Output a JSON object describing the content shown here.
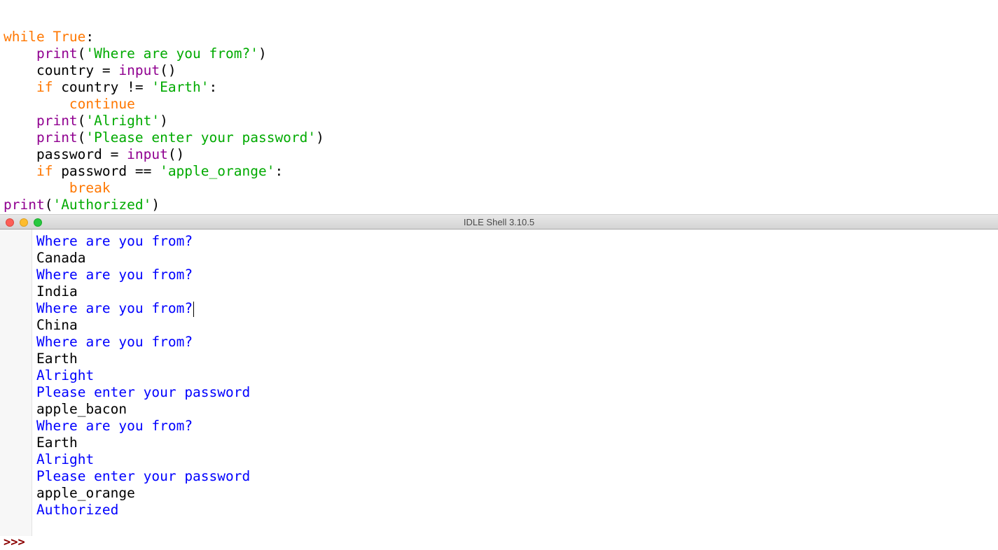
{
  "editor": {
    "lines": [
      [
        {
          "t": "while True",
          "c": "kw"
        },
        {
          "t": ":",
          "c": "plain"
        }
      ],
      [
        {
          "t": "    ",
          "c": "plain"
        },
        {
          "t": "print",
          "c": "bi"
        },
        {
          "t": "(",
          "c": "plain"
        },
        {
          "t": "'Where are you from?'",
          "c": "str"
        },
        {
          "t": ")",
          "c": "plain"
        }
      ],
      [
        {
          "t": "    country = ",
          "c": "plain"
        },
        {
          "t": "input",
          "c": "bi"
        },
        {
          "t": "()",
          "c": "plain"
        }
      ],
      [
        {
          "t": "    ",
          "c": "plain"
        },
        {
          "t": "if",
          "c": "kw"
        },
        {
          "t": " country != ",
          "c": "plain"
        },
        {
          "t": "'Earth'",
          "c": "str"
        },
        {
          "t": ":",
          "c": "plain"
        }
      ],
      [
        {
          "t": "        ",
          "c": "plain"
        },
        {
          "t": "continue",
          "c": "kw"
        }
      ],
      [
        {
          "t": "    ",
          "c": "plain"
        },
        {
          "t": "print",
          "c": "bi"
        },
        {
          "t": "(",
          "c": "plain"
        },
        {
          "t": "'Alright'",
          "c": "str"
        },
        {
          "t": ")",
          "c": "plain"
        }
      ],
      [
        {
          "t": "    ",
          "c": "plain"
        },
        {
          "t": "print",
          "c": "bi"
        },
        {
          "t": "(",
          "c": "plain"
        },
        {
          "t": "'Please enter your password'",
          "c": "str"
        },
        {
          "t": ")",
          "c": "plain"
        }
      ],
      [
        {
          "t": "    password = ",
          "c": "plain"
        },
        {
          "t": "input",
          "c": "bi"
        },
        {
          "t": "()",
          "c": "plain"
        }
      ],
      [
        {
          "t": "    ",
          "c": "plain"
        },
        {
          "t": "if",
          "c": "kw"
        },
        {
          "t": " password == ",
          "c": "plain"
        },
        {
          "t": "'apple_orange'",
          "c": "str"
        },
        {
          "t": ":",
          "c": "plain"
        }
      ],
      [
        {
          "t": "        ",
          "c": "plain"
        },
        {
          "t": "break",
          "c": "kw"
        }
      ],
      [
        {
          "t": "print",
          "c": "bi"
        },
        {
          "t": "(",
          "c": "plain"
        },
        {
          "t": "'Authorized'",
          "c": "str"
        },
        {
          "t": ")",
          "c": "plain"
        }
      ]
    ]
  },
  "shell": {
    "title": "IDLE Shell 3.10.5",
    "prompt": ">>>",
    "output": [
      {
        "text": "Where are you from?",
        "kind": "stdout"
      },
      {
        "text": "Canada",
        "kind": "stdin"
      },
      {
        "text": "Where are you from?",
        "kind": "stdout"
      },
      {
        "text": "India",
        "kind": "stdin"
      },
      {
        "text": "Where are you from?",
        "kind": "stdout",
        "cursor": true
      },
      {
        "text": "China",
        "kind": "stdin"
      },
      {
        "text": "Where are you from?",
        "kind": "stdout"
      },
      {
        "text": "Earth",
        "kind": "stdin"
      },
      {
        "text": "Alright",
        "kind": "stdout"
      },
      {
        "text": "Please enter your password",
        "kind": "stdout"
      },
      {
        "text": "apple_bacon",
        "kind": "stdin"
      },
      {
        "text": "Where are you from?",
        "kind": "stdout"
      },
      {
        "text": "Earth",
        "kind": "stdin"
      },
      {
        "text": "Alright",
        "kind": "stdout"
      },
      {
        "text": "Please enter your password",
        "kind": "stdout"
      },
      {
        "text": "apple_orange",
        "kind": "stdin"
      },
      {
        "text": "Authorized",
        "kind": "stdout"
      }
    ]
  },
  "colors": {
    "keyword": "#ff7700",
    "builtin": "#900090",
    "string": "#00aa00",
    "stdout": "#0000ff",
    "stdin": "#000000",
    "prompt": "#8b0000"
  }
}
